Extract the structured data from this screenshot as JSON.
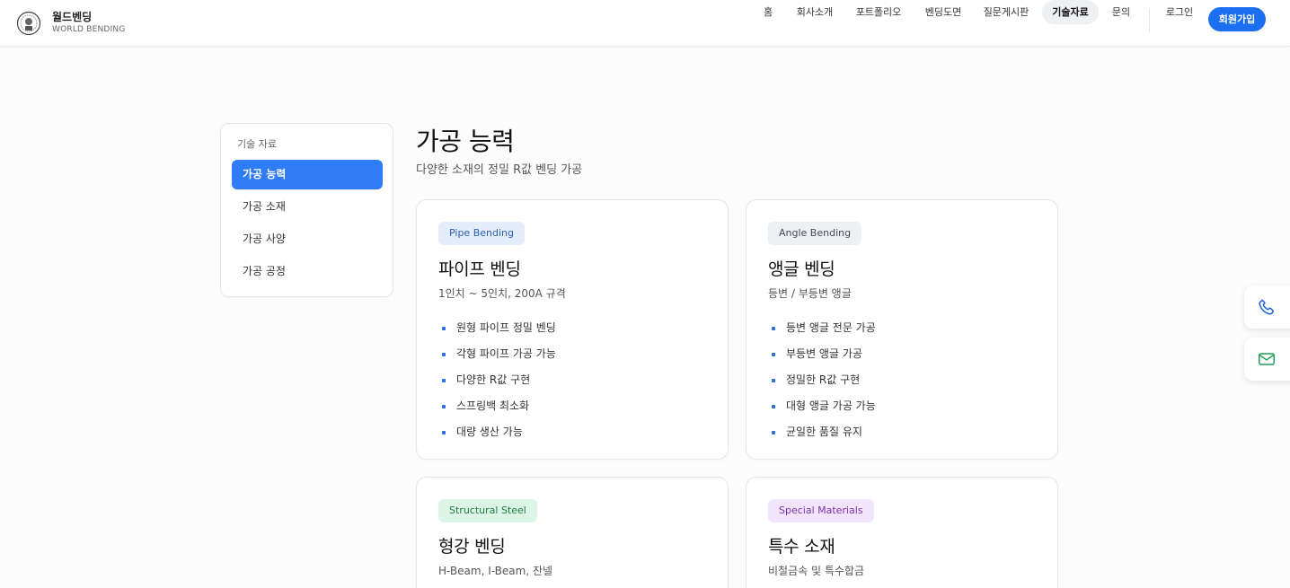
{
  "header": {
    "brand_name": "월드벤딩",
    "brand_sub": "WORLD BENDING",
    "nav": [
      {
        "label": "홈"
      },
      {
        "label": "회사소개"
      },
      {
        "label": "포트폴리오"
      },
      {
        "label": "벤딩도면"
      },
      {
        "label": "질문게시판"
      },
      {
        "label": "기술자료",
        "active": true
      },
      {
        "label": "문의"
      },
      {
        "label": "로그인"
      }
    ],
    "signup_label": "회원가입"
  },
  "sidebar": {
    "heading": "기술 자료",
    "items": [
      {
        "label": "가공 능력",
        "active": true
      },
      {
        "label": "가공 소재"
      },
      {
        "label": "가공 사양"
      },
      {
        "label": "가공 공정"
      }
    ]
  },
  "main": {
    "title": "가공 능력",
    "subtitle": "다양한 소재의 정밀 R값 벤딩 가공",
    "cards": [
      {
        "badge": "Pipe Bending",
        "title": "파이프 벤딩",
        "subtitle": "1인치 ~ 5인치, 200A 규격",
        "features": [
          "원형 파이프 정밀 벤딩",
          "각형 파이프 가공 가능",
          "다양한 R값 구현",
          "스프링백 최소화",
          "대량 생산 가능"
        ]
      },
      {
        "badge": "Angle Bending",
        "title": "앵글 벤딩",
        "subtitle": "등변 / 부등변 앵글",
        "features": [
          "등변 앵글 전문 가공",
          "부등변 앵글 가공",
          "정밀한 R값 구현",
          "대형 앵글 가공 가능",
          "균일한 품질 유지"
        ]
      },
      {
        "badge": "Structural Steel",
        "title": "형강 벤딩",
        "subtitle": "H-Beam, I-Beam, 잔넬",
        "features": []
      },
      {
        "badge": "Special Materials",
        "title": "특수 소재",
        "subtitle": "비철금속 및 특수합금",
        "features": []
      }
    ]
  },
  "floating": {
    "phone_icon": "phone-icon",
    "mail_icon": "mail-icon"
  },
  "colors": {
    "accent": "#1d6ff2",
    "sidebar_active": "#2f7cf6",
    "badge_blue_bg": "#e3edfb",
    "badge_blue_fg": "#2b5fb5",
    "badge_gray_bg": "#eef0f3",
    "badge_gray_fg": "#444a55",
    "badge_green_bg": "#dcf5e6",
    "badge_green_fg": "#1f7a45",
    "badge_purple_bg": "#f1e4fb",
    "badge_purple_fg": "#7b32b0"
  }
}
